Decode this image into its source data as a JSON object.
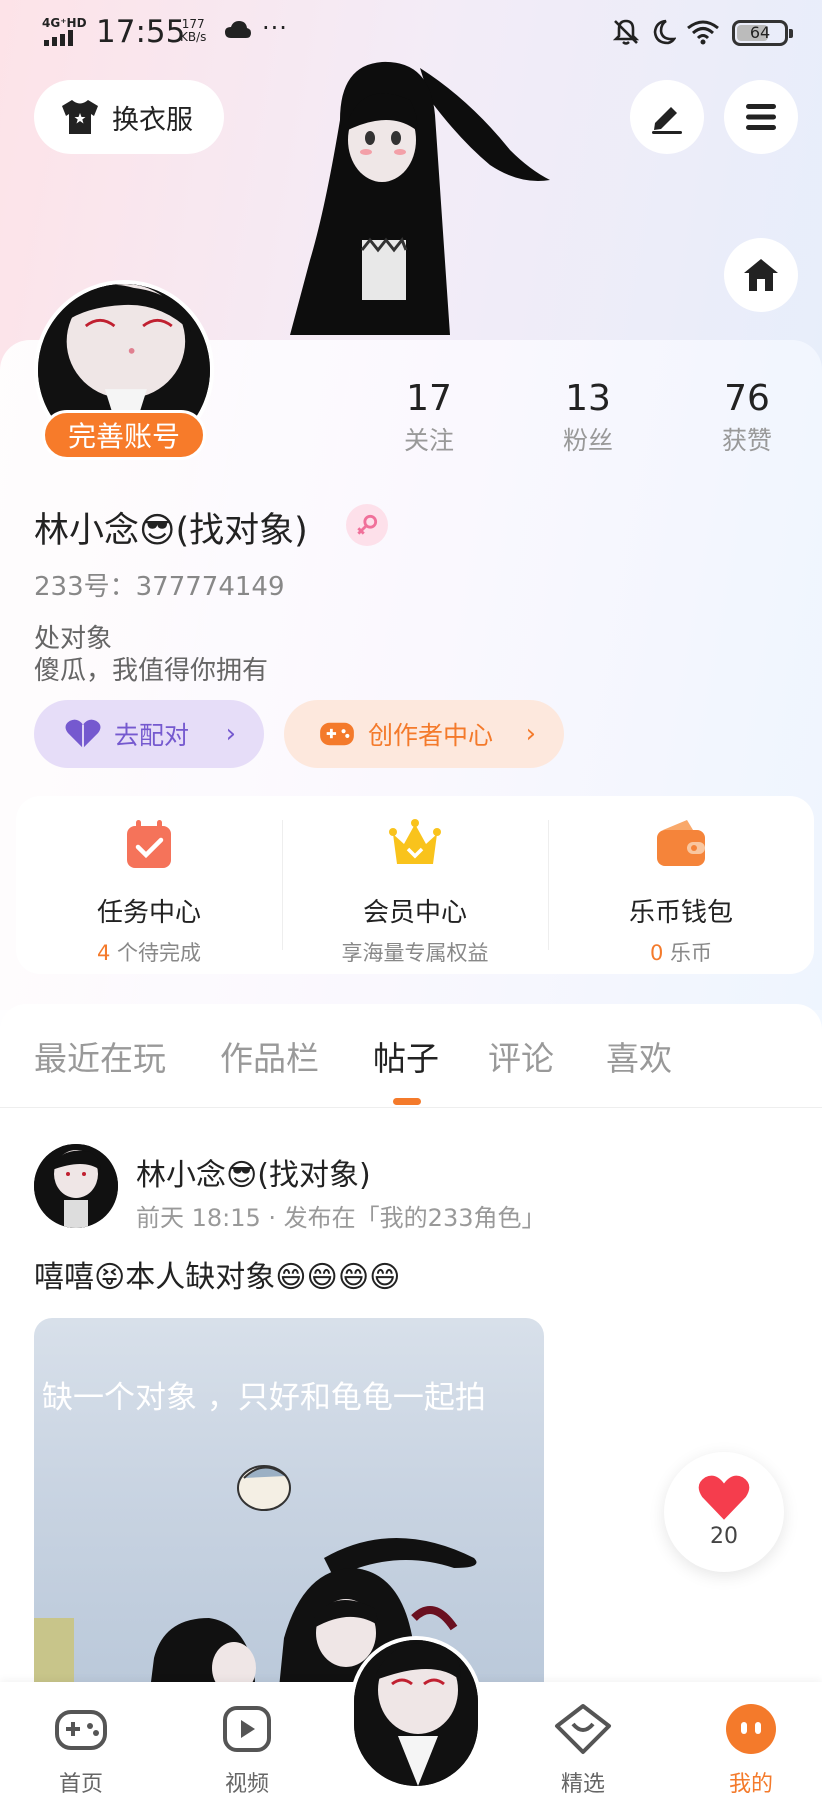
{
  "status_bar": {
    "network": "4G⁺HD",
    "time": "17:55",
    "speed_value": "177",
    "speed_unit": "KB/s",
    "dots": "···",
    "battery": "64"
  },
  "top": {
    "dress_label": "换衣服"
  },
  "profile": {
    "complete_account_label": "完善账号",
    "stats": [
      {
        "value": "17",
        "label": "关注"
      },
      {
        "value": "13",
        "label": "粉丝"
      },
      {
        "value": "76",
        "label": "获赞"
      }
    ],
    "name": "林小念😎(找对象)",
    "id_line": "233号：377774149",
    "bio_line1": "处对象",
    "bio_line2": "傻瓜，我值得你拥有",
    "tag_match": "去配对",
    "tag_creator": "创作者中心",
    "chevron": "›"
  },
  "services": [
    {
      "title": "任务中心",
      "sub_value": "4",
      "sub_text": " 个待完成"
    },
    {
      "title": "会员中心",
      "sub_value": "",
      "sub_text": "享海量专属权益"
    },
    {
      "title": "乐币钱包",
      "sub_value": "0",
      "sub_text": " 乐币"
    }
  ],
  "tabs": [
    "最近在玩",
    "作品栏",
    "帖子",
    "评论",
    "喜欢"
  ],
  "active_tab": "帖子",
  "post": {
    "author": "林小念😎(找对象)",
    "meta": "前天 18:15 · 发布在「我的233角色」",
    "text": "嘻嘻😝本人缺对象😄😄😄😄",
    "image_caption": "缺一个对象 ，只好和龟龟一起拍",
    "likes": "20"
  },
  "bottom_nav": [
    {
      "label": "首页",
      "icon": "gamepad-icon"
    },
    {
      "label": "视频",
      "icon": "video-icon"
    },
    {
      "label": "精选",
      "icon": "heart-diamond-icon"
    },
    {
      "label": "我的",
      "icon": "face-icon"
    }
  ],
  "colors": {
    "accent": "#f47a2b",
    "match_purple": "#7559cf",
    "match_bg": "#e6ddf8",
    "creator_bg": "#fde8dd"
  }
}
